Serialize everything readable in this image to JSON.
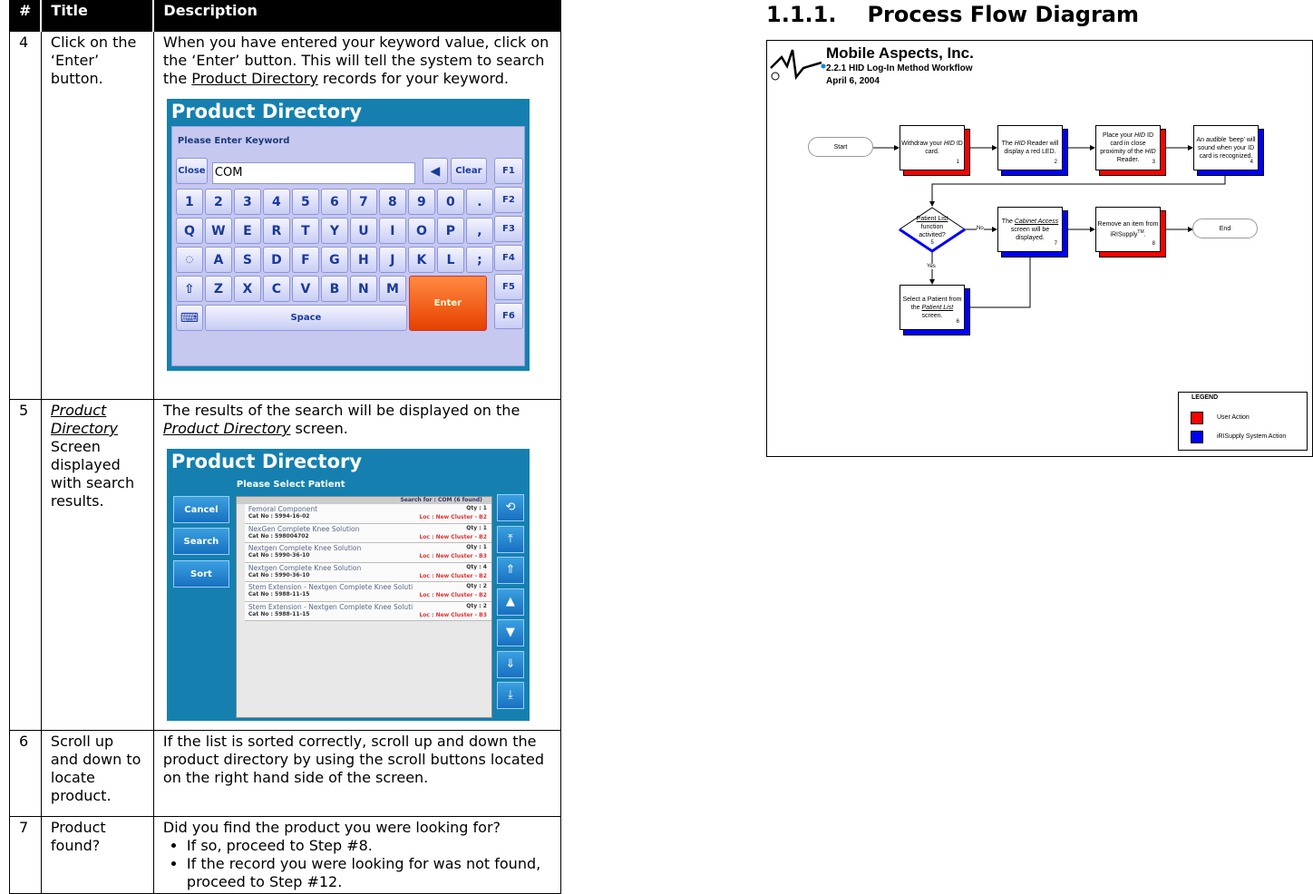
{
  "table": {
    "headers": [
      "#",
      "Title",
      "Description"
    ],
    "rows": [
      {
        "num": "4",
        "title": "Click on the ‘Enter’ button.",
        "desc_a": "When you have entered your keyword value, click on the ‘Enter’ button.  This will tell the system to search the ",
        "desc_link": "Product Directory",
        "desc_b": " records for your keyword."
      },
      {
        "num": "5",
        "title_link": "Product Directory",
        "title_rest": " Screen displayed with search results.",
        "desc_a": "The results of the search will be displayed on the ",
        "desc_link": "Product Directory",
        "desc_b": " screen."
      },
      {
        "num": "6",
        "title": "Scroll up and down to locate product.",
        "desc": "If the list is sorted correctly, scroll up and down the product directory by using the scroll buttons located on the right hand side of the screen."
      },
      {
        "num": "7",
        "title": "Product found?",
        "desc": "Did you find the product you were looking for?",
        "bullets": [
          "If so, proceed to Step #8.",
          "If the record you were looking for was not found, proceed to Step #12."
        ]
      }
    ]
  },
  "keyword_screen": {
    "title": "Product Directory",
    "prompt": "Please Enter Keyword",
    "close": "Close",
    "input_value": "COM",
    "clear": "Clear",
    "rows": [
      [
        "1",
        "2",
        "3",
        "4",
        "5",
        "6",
        "7",
        "8",
        "9",
        "0",
        "."
      ],
      [
        "Q",
        "W",
        "E",
        "R",
        "T",
        "Y",
        "U",
        "I",
        "O",
        "P",
        ","
      ],
      [
        "A",
        "S",
        "D",
        "F",
        "G",
        "H",
        "J",
        "K",
        "L",
        ";"
      ],
      [
        "Z",
        "X",
        "C",
        "V",
        "B",
        "N",
        "M"
      ]
    ],
    "enter": "Enter",
    "space": "Space",
    "fkeys": [
      "F1",
      "F2",
      "F3",
      "F4",
      "F5",
      "F6"
    ]
  },
  "results_screen": {
    "title": "Product Directory",
    "subtitle": "Please Select Patient",
    "buttons": [
      "Cancel",
      "Search",
      "Sort"
    ],
    "search_status": "Search for : COM (6 found)",
    "items": [
      {
        "name": "Femoral Component",
        "cat": "Cat No : 5994-16-02",
        "qty": "Qty : 1",
        "loc": "Loc : New Cluster -  B2"
      },
      {
        "name": "NexGen Complete Knee Solution",
        "cat": "Cat No : 598004702",
        "qty": "Qty : 1",
        "loc": "Loc : New Cluster -  B2"
      },
      {
        "name": "Nextgen Complete Knee Solution",
        "cat": "Cat No : 5990-36-10",
        "qty": "Qty : 1",
        "loc": "Loc : New Cluster -  B3"
      },
      {
        "name": "Nextgen Complete Knee Solution",
        "cat": "Cat No : 5990-36-10",
        "qty": "Qty : 4",
        "loc": "Loc : New Cluster -  B2"
      },
      {
        "name": "Stem Extension - Nextgen Complete Knee Soluti",
        "cat": "Cat No : 5988-11-15",
        "qty": "Qty : 2",
        "loc": "Loc : New Cluster -  B2"
      },
      {
        "name": "Stem Extension - Nextgen Complete Knee Soluti",
        "cat": "Cat No : 5988-11-15",
        "qty": "Qty : 2",
        "loc": "Loc : New Cluster -  B3"
      }
    ],
    "scroll_icons": [
      "refresh-icon",
      "scroll-top-icon",
      "page-up-icon",
      "up-icon",
      "down-icon",
      "page-down-icon",
      "scroll-bottom-icon"
    ]
  },
  "section": {
    "number": "1.1.1.",
    "title": "Process Flow Diagram"
  },
  "diagram": {
    "company": "Mobile Aspects, Inc.",
    "subtitle": "2.2.1 HID Log-In Method Workflow",
    "date": "April 6, 2004",
    "start": "Start",
    "end": "End",
    "no": "No",
    "yes": "Yes",
    "n1": [
      "Withdraw your ",
      "HID",
      " ID card.",
      "1"
    ],
    "n2": [
      "The ",
      "HID",
      " Reader will display a red LED.",
      "2"
    ],
    "n3": [
      "Place your ",
      "HID",
      " ID card in close proximity of the ",
      "HID",
      " Reader.",
      "3"
    ],
    "n4": [
      "An audible ‘beep’ will sound when your ID card is recognized.",
      "4"
    ],
    "n5": [
      "Patient List",
      " function activited?",
      "5"
    ],
    "n6": [
      "Select a Patient from the ",
      "Patient List",
      "  screen.",
      "6"
    ],
    "n7": [
      "The ",
      "Cabinet Access",
      " screen will be displayed.",
      "7"
    ],
    "n8": [
      "Remove an item from iRISupply",
      "TM",
      ".",
      "8"
    ],
    "legend": {
      "title": "LEGEND",
      "items": [
        {
          "label": "User Action",
          "color": "#ff0000"
        },
        {
          "label": "iRISupply System Action",
          "color": "#0000ff"
        }
      ]
    }
  }
}
